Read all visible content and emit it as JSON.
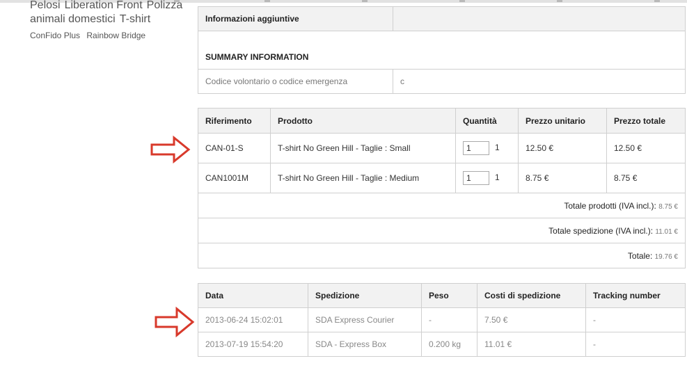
{
  "categories": {
    "row1": [
      "Pelosi",
      "Liberation Front",
      "Polizza"
    ],
    "row2": [
      "animali domestici",
      "T-shirt"
    ],
    "sub": [
      "ConFido Plus",
      "Rainbow Bridge"
    ]
  },
  "info_table": {
    "header_label": "Informazioni aggiuntive",
    "summary_label": "SUMMARY INFORMATION",
    "code_label": "Codice volontario o codice emergenza",
    "code_value": "c"
  },
  "products_table": {
    "headers": [
      "Riferimento",
      "Prodotto",
      "Quantità",
      "Prezzo unitario",
      "Prezzo totale"
    ],
    "rows": [
      {
        "ref": "CAN-01-S",
        "product": "T-shirt No Green Hill - Taglie : Small",
        "qty_input": "1",
        "qty": "1",
        "unit": "12.50 €",
        "total": "12.50 €"
      },
      {
        "ref": "CAN1001M",
        "product": "T-shirt No Green Hill - Taglie : Medium",
        "qty_input": "1",
        "qty": "1",
        "unit": "8.75 €",
        "total": "8.75 €"
      }
    ],
    "totals": [
      {
        "label": "Totale prodotti (IVA incl.):",
        "value": "8.75 €"
      },
      {
        "label": "Totale spedizione (IVA incl.):",
        "value": "11.01 €"
      },
      {
        "label": "Totale:",
        "value": "19.76 €"
      }
    ]
  },
  "shipping_table": {
    "headers": [
      "Data",
      "Spedizione",
      "Peso",
      "Costi di spedizione",
      "Tracking number"
    ],
    "rows": [
      {
        "date": "2013-06-24 15:02:01",
        "carrier": "SDA Express Courier",
        "weight": "-",
        "cost": "7.50 €",
        "tracking": "-"
      },
      {
        "date": "2013-07-19 15:54:20",
        "carrier": "SDA - Express Box",
        "weight": "0.200 kg",
        "cost": "11.01 €",
        "tracking": "-"
      }
    ]
  },
  "colors": {
    "arrow": "#d8392b",
    "header_bg": "#f2f2f2",
    "border": "#cfcfcf"
  }
}
